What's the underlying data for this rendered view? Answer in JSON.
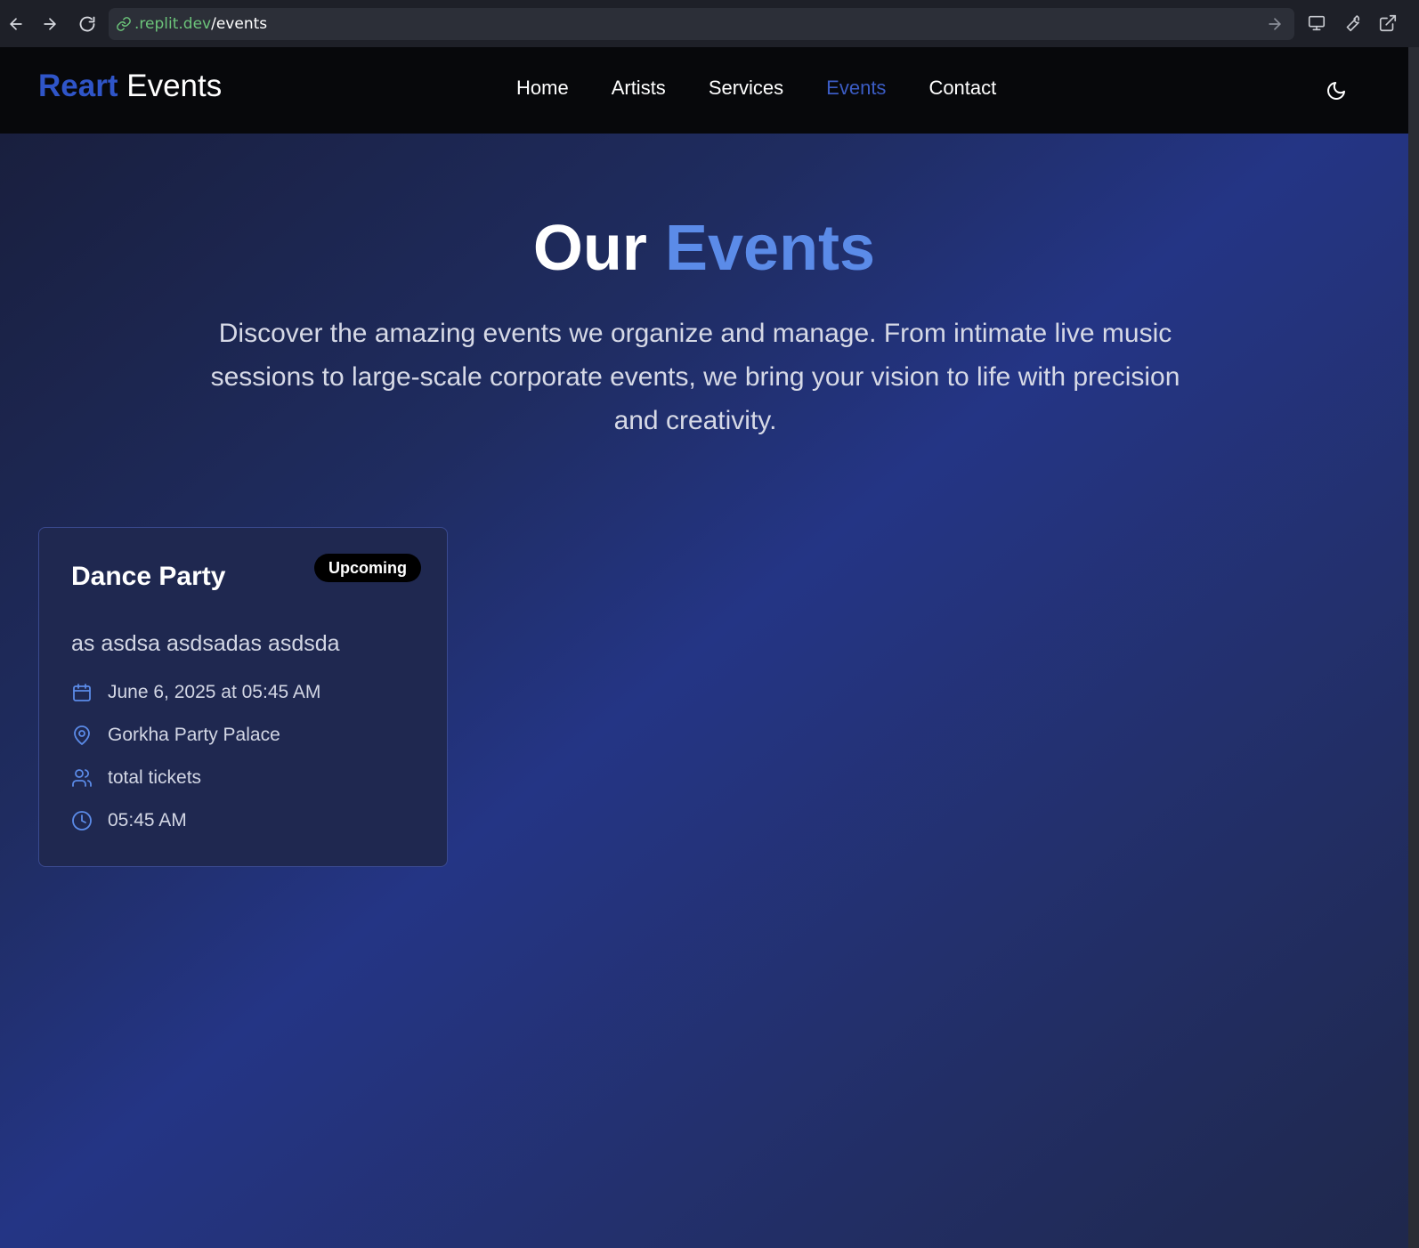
{
  "browser": {
    "url_domain": ".replit.dev",
    "url_path": "/events"
  },
  "header": {
    "logo_accent": "Reart",
    "logo_rest": "Events",
    "nav": [
      {
        "label": "Home"
      },
      {
        "label": "Artists"
      },
      {
        "label": "Services"
      },
      {
        "label": "Events"
      },
      {
        "label": "Contact"
      }
    ],
    "active_nav": "Events",
    "theme_toggle_icon": "moon-icon"
  },
  "hero": {
    "title_main": "Our",
    "title_accent": "Events",
    "intro": "Discover the amazing events we organize and manage. From intimate live music sessions to large-scale corporate events, we bring your vision to life with precision and creativity."
  },
  "events": [
    {
      "title": "Dance Party",
      "status": "Upcoming",
      "description": "as asdsa asdsadas asdsda",
      "date": "June 6, 2025 at 05:45 AM",
      "venue": "Gorkha Party Palace",
      "tickets": "total tickets",
      "time": "05:45 AM"
    }
  ],
  "colors": {
    "accent": "#5b8be8",
    "logo_accent": "#2f55c8",
    "active_nav": "#3b5cc4",
    "header_bg": "#07080b",
    "card_bg": "#1f2850"
  }
}
